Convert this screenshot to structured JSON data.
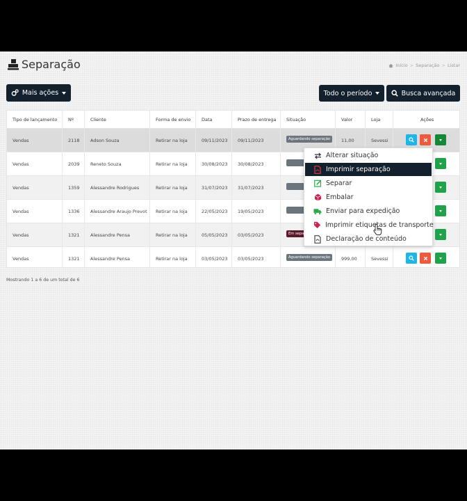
{
  "header": {
    "title": "Separação",
    "breadcrumb": [
      "Início",
      "Separação",
      "Listar"
    ]
  },
  "toolbar": {
    "more_actions": "Mais ações",
    "period": "Todo o período",
    "advanced_search": "Busca avançada"
  },
  "table": {
    "columns": [
      "Tipo de lançamento",
      "Nº",
      "Cliente",
      "Forma de envio",
      "Data",
      "Prazo de entrega",
      "Situação",
      "Valor",
      "Loja",
      "Ações"
    ],
    "rows": [
      {
        "tipo": "Vendas",
        "num": "2118",
        "cliente": "Adson Souza",
        "forma": "Retirar na loja",
        "data": "09/11/2023",
        "prazo": "09/11/2023",
        "situacao": "Aguardando separação",
        "valor": "11,00",
        "loja": "Sevessi"
      },
      {
        "tipo": "Vendas",
        "num": "2039",
        "cliente": "Reneto Souza",
        "forma": "Retirar na loja",
        "data": "30/08/2023",
        "prazo": "30/08/2023",
        "situacao": "",
        "valor": "",
        "loja": ""
      },
      {
        "tipo": "Vendas",
        "num": "1359",
        "cliente": "Alessandre Rodrigues",
        "forma": "Retirar na loja",
        "data": "31/07/2023",
        "prazo": "31/07/2023",
        "situacao": "",
        "valor": "",
        "loja": ""
      },
      {
        "tipo": "Vendas",
        "num": "1336",
        "cliente": "Alessandre Araujo Prevot",
        "forma": "Retirar na loja",
        "data": "22/05/2023",
        "prazo": "19/05/2023",
        "situacao": "",
        "valor": "",
        "loja": ""
      },
      {
        "tipo": "Vendas",
        "num": "1321",
        "cliente": "Alessandre Pensa",
        "forma": "Retirar na loja",
        "data": "05/05/2023",
        "prazo": "03/05/2023",
        "situacao": "Em separa",
        "valor": "",
        "loja": ""
      },
      {
        "tipo": "Vendas",
        "num": "1321",
        "cliente": "Alessandre Pensa",
        "forma": "Retirar na loja",
        "data": "03/05/2023",
        "prazo": "03/05/2023",
        "situacao": "Aguardando separação",
        "valor": "999,00",
        "loja": "Sevessi"
      }
    ]
  },
  "footer": {
    "showing": "Mostrando 1 a 6 de um total de 6"
  },
  "dropdown": {
    "items": [
      {
        "label": "Alterar situação",
        "icon": "swap-arrows-icon"
      },
      {
        "label": "Imprimir separação",
        "icon": "pdf-icon"
      },
      {
        "label": "Separar",
        "icon": "edit-icon"
      },
      {
        "label": "Embalar",
        "icon": "box-icon"
      },
      {
        "label": "Enviar para expedição",
        "icon": "truck-icon"
      },
      {
        "label": "Imprimir etiquetas de transporte",
        "icon": "tag-icon"
      },
      {
        "label": "Declaração de conteúdo",
        "icon": "file-icon"
      }
    ]
  },
  "colors": {
    "primary_dark": "#13212e",
    "view_button": "#20b5e6",
    "delete_button": "#ee5a3c",
    "more_button": "#1fa34a",
    "badge_gray": "#6c757d",
    "badge_dark": "#5a1b2b"
  }
}
